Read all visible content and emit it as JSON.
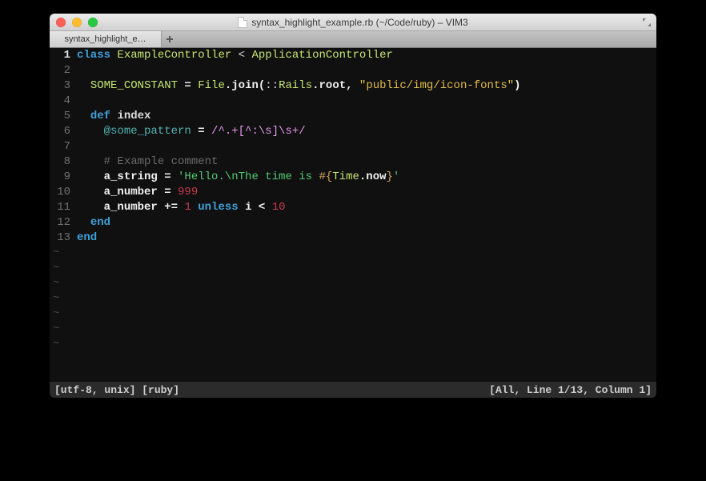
{
  "window": {
    "title": "syntax_highlight_example.rb (~/Code/ruby) – VIM3"
  },
  "tabs": [
    {
      "label": "syntax_highlight_e…"
    }
  ],
  "statusbar": {
    "left": "[utf-8, unix]  [ruby]",
    "right": "[All, Line 1/13, Column 1]"
  },
  "code": {
    "current_line": 1,
    "total_lines": 13,
    "tilde_rows": 7,
    "lines": [
      {
        "n": 1,
        "spans": [
          {
            "cls": "tk-kw",
            "t": "class"
          },
          {
            "cls": "tk-op",
            "t": " "
          },
          {
            "cls": "tk-class",
            "t": "ExampleController"
          },
          {
            "cls": "tk-op",
            "t": " < "
          },
          {
            "cls": "tk-class",
            "t": "ApplicationController"
          }
        ]
      },
      {
        "n": 2,
        "spans": []
      },
      {
        "n": 3,
        "spans": [
          {
            "cls": "tk-op",
            "t": "  "
          },
          {
            "cls": "tk-const",
            "t": "SOME_CONSTANT"
          },
          {
            "cls": "tk-white",
            "t": " = "
          },
          {
            "cls": "tk-upper",
            "t": "File"
          },
          {
            "cls": "tk-white",
            "t": ".join("
          },
          {
            "cls": "tk-op",
            "t": "::"
          },
          {
            "cls": "tk-upper",
            "t": "Rails"
          },
          {
            "cls": "tk-white",
            "t": ".root, "
          },
          {
            "cls": "tk-str",
            "t": "\"public/img/icon-fonts\""
          },
          {
            "cls": "tk-white",
            "t": ")"
          }
        ]
      },
      {
        "n": 4,
        "spans": []
      },
      {
        "n": 5,
        "spans": [
          {
            "cls": "tk-op",
            "t": "  "
          },
          {
            "cls": "tk-kw",
            "t": "def"
          },
          {
            "cls": "tk-op",
            "t": " "
          },
          {
            "cls": "tk-ident",
            "t": "index"
          }
        ]
      },
      {
        "n": 6,
        "spans": [
          {
            "cls": "tk-op",
            "t": "    "
          },
          {
            "cls": "tk-ivar",
            "t": "@some_pattern"
          },
          {
            "cls": "tk-white",
            "t": " = "
          },
          {
            "cls": "tk-regex",
            "t": "/^.+[^:\\s]\\s+/"
          }
        ]
      },
      {
        "n": 7,
        "spans": []
      },
      {
        "n": 8,
        "spans": [
          {
            "cls": "tk-op",
            "t": "    "
          },
          {
            "cls": "tk-comment",
            "t": "# Example comment"
          }
        ]
      },
      {
        "n": 9,
        "spans": [
          {
            "cls": "tk-op",
            "t": "    "
          },
          {
            "cls": "tk-white",
            "t": "a_string = "
          },
          {
            "cls": "tk-strs",
            "t": "'Hello.\\nThe time is "
          },
          {
            "cls": "tk-interp",
            "t": "#{"
          },
          {
            "cls": "tk-upper",
            "t": "Time"
          },
          {
            "cls": "tk-white",
            "t": ".now"
          },
          {
            "cls": "tk-interp",
            "t": "}"
          },
          {
            "cls": "tk-strs",
            "t": "'"
          }
        ]
      },
      {
        "n": 10,
        "spans": [
          {
            "cls": "tk-op",
            "t": "    "
          },
          {
            "cls": "tk-white",
            "t": "a_number = "
          },
          {
            "cls": "tk-num",
            "t": "999"
          }
        ]
      },
      {
        "n": 11,
        "spans": [
          {
            "cls": "tk-op",
            "t": "    "
          },
          {
            "cls": "tk-white",
            "t": "a_number += "
          },
          {
            "cls": "tk-num",
            "t": "1"
          },
          {
            "cls": "tk-op",
            "t": " "
          },
          {
            "cls": "tk-kw",
            "t": "unless"
          },
          {
            "cls": "tk-white",
            "t": " i < "
          },
          {
            "cls": "tk-num",
            "t": "10"
          }
        ]
      },
      {
        "n": 12,
        "spans": [
          {
            "cls": "tk-op",
            "t": "  "
          },
          {
            "cls": "tk-kw",
            "t": "end"
          }
        ]
      },
      {
        "n": 13,
        "spans": [
          {
            "cls": "tk-kw",
            "t": "end"
          }
        ]
      }
    ]
  }
}
